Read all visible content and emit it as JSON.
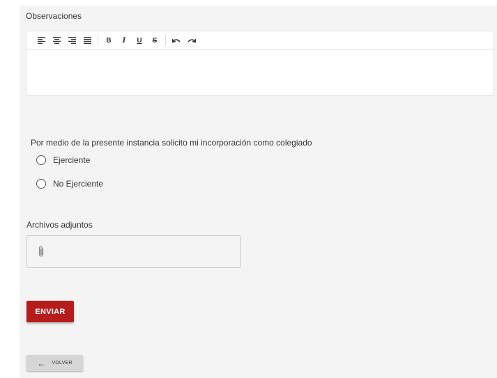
{
  "observaciones": {
    "label": "Observaciones",
    "toolbar_icons": [
      "align-left-icon",
      "align-center-icon",
      "align-right-icon",
      "align-justify-icon",
      "bold-icon",
      "italic-icon",
      "underline-icon",
      "strikethrough-icon",
      "undo-icon",
      "redo-icon"
    ],
    "bold_glyph": "B",
    "italic_glyph": "I",
    "underline_glyph": "U",
    "strike_glyph": "S",
    "content": ""
  },
  "incorporacion": {
    "question": "Por medio de la presente instancia solicito mi incorporación como colegiado",
    "options": [
      {
        "label": "Ejerciente",
        "selected": false
      },
      {
        "label": "No Ejerciente",
        "selected": false
      }
    ]
  },
  "adjuntos": {
    "label": "Archivos adjuntos",
    "icon": "paperclip-icon"
  },
  "actions": {
    "send_label": "ENVIAR",
    "back_label": "VOLVER",
    "back_icon": "arrow-left-icon",
    "send_color": "#b71c1c"
  }
}
